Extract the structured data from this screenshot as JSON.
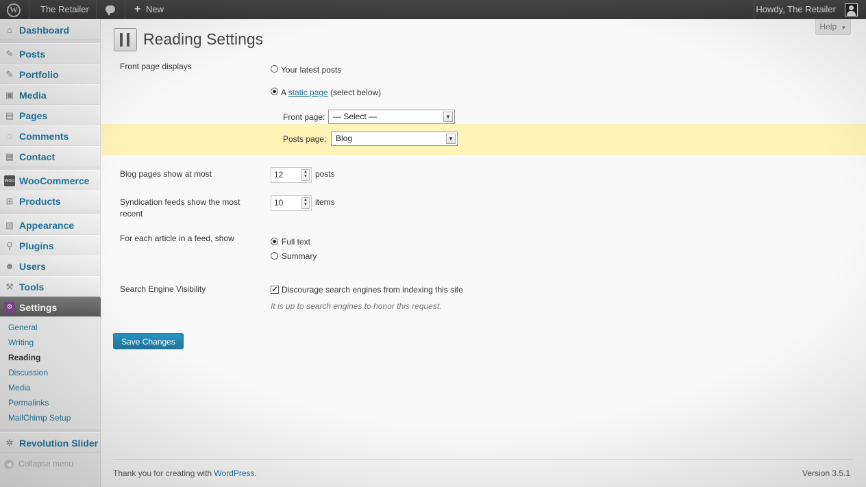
{
  "adminbar": {
    "site_name": "The Retailer",
    "new_label": "New",
    "howdy": "Howdy, The Retailer"
  },
  "sidebar": {
    "items": [
      {
        "label": "Dashboard",
        "icon": "home-icon"
      },
      {
        "label": "Posts",
        "icon": "pin-icon"
      },
      {
        "label": "Portfolio",
        "icon": "pin-icon"
      },
      {
        "label": "Media",
        "icon": "media-icon"
      },
      {
        "label": "Pages",
        "icon": "pages-icon"
      },
      {
        "label": "Comments",
        "icon": "comment-icon"
      },
      {
        "label": "Contact",
        "icon": "contact-icon"
      },
      {
        "label": "WooCommerce",
        "icon": "woo-icon"
      },
      {
        "label": "Products",
        "icon": "cart-icon"
      },
      {
        "label": "Appearance",
        "icon": "appearance-icon"
      },
      {
        "label": "Plugins",
        "icon": "plugin-icon"
      },
      {
        "label": "Users",
        "icon": "users-icon"
      },
      {
        "label": "Tools",
        "icon": "tools-icon"
      },
      {
        "label": "Settings",
        "icon": "settings-icon"
      },
      {
        "label": "Revolution Slider",
        "icon": "gear-icon"
      }
    ],
    "submenu": [
      "General",
      "Writing",
      "Reading",
      "Discussion",
      "Media",
      "Permalinks",
      "MailChimp Setup"
    ],
    "collapse_label": "Collapse menu"
  },
  "main": {
    "help_label": "Help",
    "title": "Reading Settings",
    "front_page_displays": {
      "label": "Front page displays",
      "option_latest": "Your latest posts",
      "option_static_prefix": "A ",
      "option_static_link": "static page",
      "option_static_suffix": " (select below)",
      "front_page_label": "Front page:",
      "front_page_value": "— Select —",
      "posts_page_label": "Posts page:",
      "posts_page_value": "Blog",
      "selected": "static"
    },
    "blog_pages": {
      "label": "Blog pages show at most",
      "value": "12",
      "unit": "posts"
    },
    "syndication": {
      "label": "Syndication feeds show the most recent",
      "value": "10",
      "unit": "items"
    },
    "feed_article": {
      "label": "For each article in a feed, show",
      "option_full": "Full text",
      "option_summary": "Summary",
      "selected": "full"
    },
    "search_visibility": {
      "label": "Search Engine Visibility",
      "checkbox_label": "Discourage search engines from indexing this site",
      "checked": true,
      "hint": "It is up to search engines to honor this request."
    },
    "save_label": "Save Changes",
    "footer_prefix": "Thank you for creating with ",
    "footer_link": "WordPress",
    "footer_suffix": ".",
    "version": "Version 3.5.1"
  },
  "colors": {
    "accent": "#21759b",
    "highlight": "#fff3b8",
    "adminbar": "#464646"
  }
}
